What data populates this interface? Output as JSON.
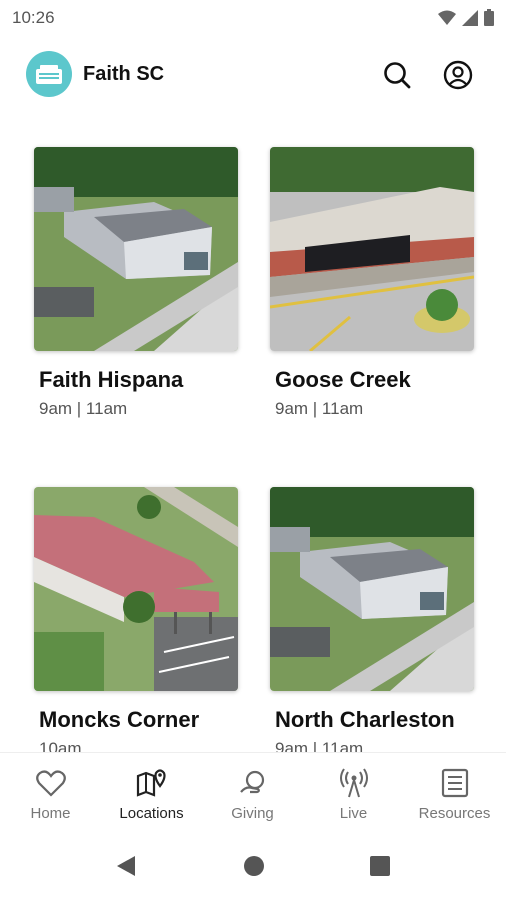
{
  "status_bar": {
    "time": "10:26"
  },
  "header": {
    "title": "Faith SC",
    "logo_icon": "church-logo-icon",
    "brand_color": "#5cc7cc"
  },
  "locations": [
    {
      "name": "Faith Hispana",
      "times": "9am | 11am"
    },
    {
      "name": "Goose Creek",
      "times": "9am | 11am"
    },
    {
      "name": "Moncks Corner",
      "times": "10am"
    },
    {
      "name": "North Charleston",
      "times": "9am | 11am"
    }
  ],
  "bottom_nav": {
    "active": "Locations",
    "items": [
      {
        "label": "Home",
        "icon": "heart-icon"
      },
      {
        "label": "Locations",
        "icon": "map-pin-icon"
      },
      {
        "label": "Giving",
        "icon": "giving-icon"
      },
      {
        "label": "Live",
        "icon": "broadcast-icon"
      },
      {
        "label": "Resources",
        "icon": "document-icon"
      }
    ]
  }
}
